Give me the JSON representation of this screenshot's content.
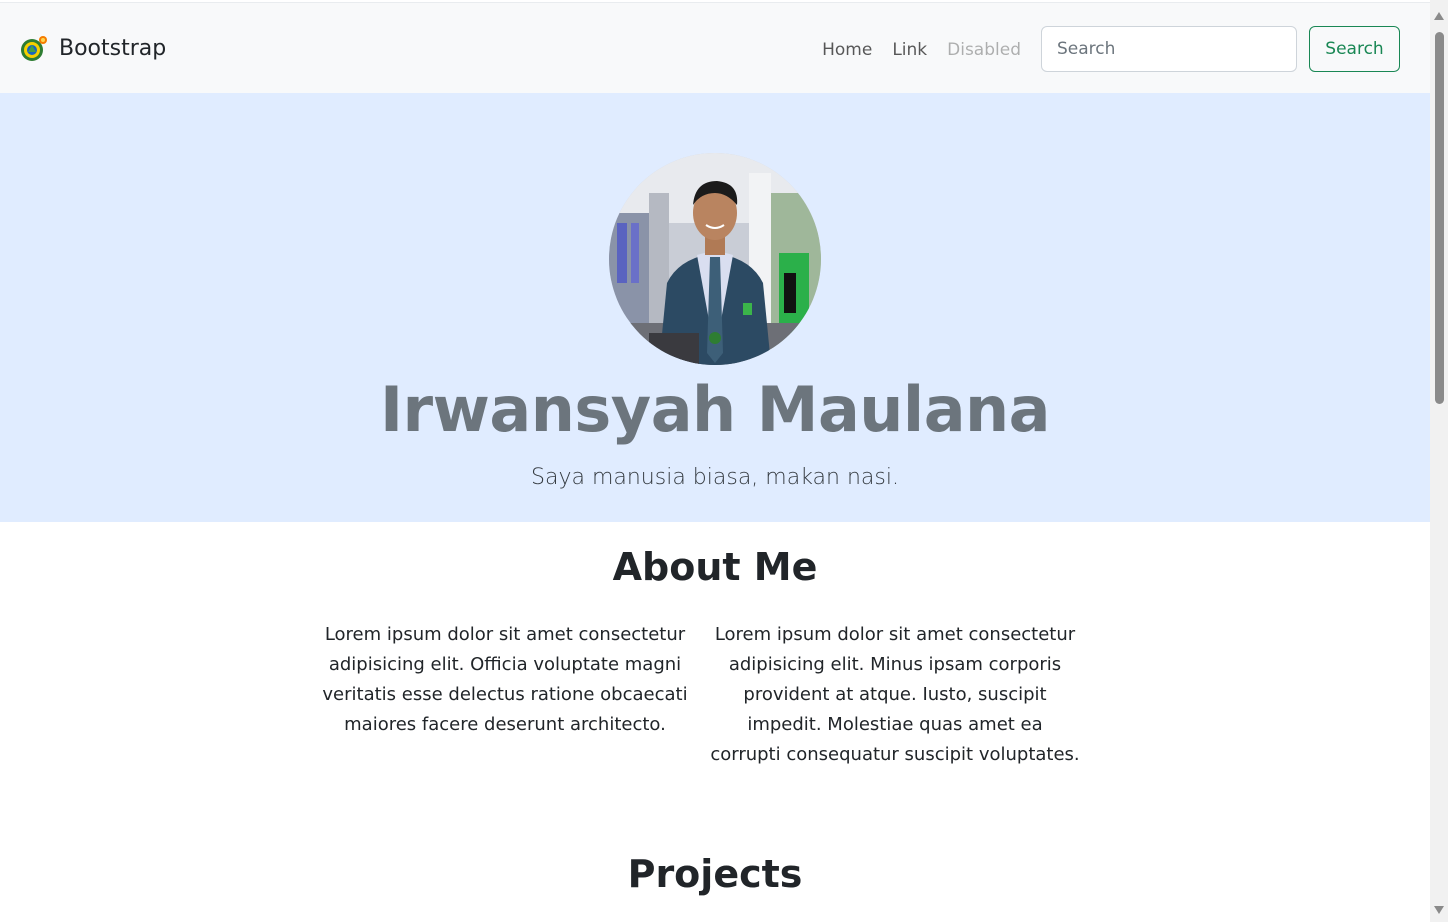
{
  "navbar": {
    "brand": "Bootstrap",
    "links": [
      {
        "label": "Home"
      },
      {
        "label": "Link"
      },
      {
        "label": "Disabled"
      }
    ],
    "search_placeholder": "Search",
    "search_button": "Search"
  },
  "hero": {
    "name": "Irwansyah Maulana",
    "tagline": "Saya manusia biasa, makan nasi.",
    "background_color": "#e0ecff"
  },
  "about": {
    "title": "About Me",
    "col1": "Lorem ipsum dolor sit amet consectetur adipisicing elit. Officia voluptate magni veritatis esse delectus ratione obcaecati maiores facere deserunt architecto.",
    "col2": "Lorem ipsum dolor sit amet consectetur adipisicing elit. Minus ipsam corporis provident at atque. Iusto, suscipit impedit. Molestiae quas amet ea corrupti consequatur suscipit voluptates."
  },
  "projects": {
    "title": "Projects"
  },
  "colors": {
    "accent_green": "#198754",
    "muted_gray": "#6c757d"
  }
}
